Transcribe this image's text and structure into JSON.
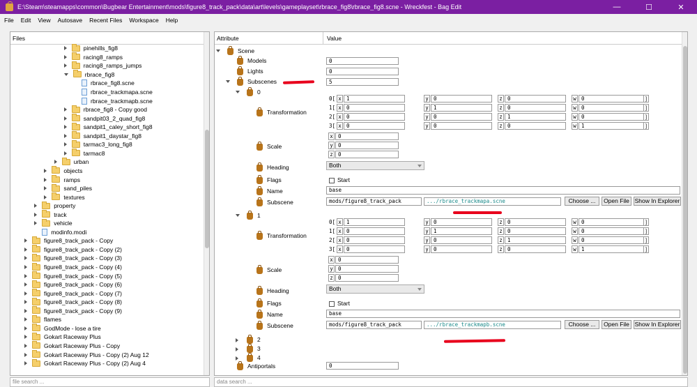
{
  "window": {
    "title": "E:\\Steam\\steamapps\\common\\Bugbear Entertainment\\mods\\figure8_track_pack\\data\\art\\levels\\gameplayset\\rbrace_fig8\\rbrace_fig8.scne - Wreckfest - Bag Edit",
    "min": "—",
    "max": "☐",
    "close": "✕"
  },
  "menu": [
    "File",
    "Edit",
    "View",
    "Autosave",
    "Recent Files",
    "Workspace",
    "Help"
  ],
  "files_panel": {
    "header": "Files",
    "search_placeholder": "file search ...",
    "items": [
      {
        "label": "pinehills_fig8",
        "depth": 4,
        "type": "folder",
        "arrow": "right"
      },
      {
        "label": "racing8_ramps",
        "depth": 4,
        "type": "folder",
        "arrow": "right"
      },
      {
        "label": "racing8_ramps_jumps",
        "depth": 4,
        "type": "folder",
        "arrow": "right"
      },
      {
        "label": "rbrace_fig8",
        "depth": 4,
        "type": "folder",
        "arrow": "down"
      },
      {
        "label": "rbrace_fig8.scne",
        "depth": 5,
        "type": "file",
        "arrow": "none"
      },
      {
        "label": "rbrace_trackmapa.scne",
        "depth": 5,
        "type": "file",
        "arrow": "none"
      },
      {
        "label": "rbrace_trackmapb.scne",
        "depth": 5,
        "type": "file",
        "arrow": "none"
      },
      {
        "label": "rbrace_fig8 - Copy good",
        "depth": 4,
        "type": "folder",
        "arrow": "right"
      },
      {
        "label": "sandpit03_2_quad_fig8",
        "depth": 4,
        "type": "folder",
        "arrow": "right"
      },
      {
        "label": "sandpit1_caley_short_fig8",
        "depth": 4,
        "type": "folder",
        "arrow": "right"
      },
      {
        "label": "sandpit1_daystar_fig8",
        "depth": 4,
        "type": "folder",
        "arrow": "right"
      },
      {
        "label": "tarmac3_long_fig8",
        "depth": 4,
        "type": "folder",
        "arrow": "right"
      },
      {
        "label": "tarmac8",
        "depth": 4,
        "type": "folder",
        "arrow": "right"
      },
      {
        "label": "urban",
        "depth": 3,
        "type": "folder",
        "arrow": "right"
      },
      {
        "label": "objects",
        "depth": 2,
        "type": "folder",
        "arrow": "right"
      },
      {
        "label": "ramps",
        "depth": 2,
        "type": "folder",
        "arrow": "right"
      },
      {
        "label": "sand_piles",
        "depth": 2,
        "type": "folder",
        "arrow": "right"
      },
      {
        "label": "textures",
        "depth": 2,
        "type": "folder",
        "arrow": "right"
      },
      {
        "label": "property",
        "depth": 1,
        "type": "folder",
        "arrow": "right"
      },
      {
        "label": "track",
        "depth": 1,
        "type": "folder",
        "arrow": "right"
      },
      {
        "label": "vehicle",
        "depth": 1,
        "type": "folder",
        "arrow": "right"
      },
      {
        "label": "modinfo.modi",
        "depth": 1,
        "type": "file",
        "arrow": "none"
      },
      {
        "label": "figure8_track_pack - Copy",
        "depth": 0,
        "type": "folder",
        "arrow": "right"
      },
      {
        "label": "figure8_track_pack - Copy (2)",
        "depth": 0,
        "type": "folder",
        "arrow": "right"
      },
      {
        "label": "figure8_track_pack - Copy (3)",
        "depth": 0,
        "type": "folder",
        "arrow": "right"
      },
      {
        "label": "figure8_track_pack - Copy (4)",
        "depth": 0,
        "type": "folder",
        "arrow": "right"
      },
      {
        "label": "figure8_track_pack - Copy (5)",
        "depth": 0,
        "type": "folder",
        "arrow": "right"
      },
      {
        "label": "figure8_track_pack - Copy (6)",
        "depth": 0,
        "type": "folder",
        "arrow": "right"
      },
      {
        "label": "figure8_track_pack - Copy (7)",
        "depth": 0,
        "type": "folder",
        "arrow": "right"
      },
      {
        "label": "figure8_track_pack - Copy (8)",
        "depth": 0,
        "type": "folder",
        "arrow": "right"
      },
      {
        "label": "figure8_track_pack - Copy (9)",
        "depth": 0,
        "type": "folder",
        "arrow": "right"
      },
      {
        "label": "flames",
        "depth": 0,
        "type": "folder",
        "arrow": "right"
      },
      {
        "label": "GodMode - lose a tire",
        "depth": 0,
        "type": "folder",
        "arrow": "right"
      },
      {
        "label": "Gokart Raceway Plus",
        "depth": 0,
        "type": "folder",
        "arrow": "right"
      },
      {
        "label": "Gokart Raceway Plus - Copy",
        "depth": 0,
        "type": "folder",
        "arrow": "right"
      },
      {
        "label": "Gokart Raceway Plus - Copy (2) Aug 12",
        "depth": 0,
        "type": "folder",
        "arrow": "right"
      },
      {
        "label": "Gokart Raceway Plus - Copy (2) Aug 4",
        "depth": 0,
        "type": "folder",
        "arrow": "right"
      }
    ]
  },
  "attr_panel": {
    "col_attribute": "Attribute",
    "col_value": "Value",
    "search_placeholder": "data search ...",
    "scene_label": "Scene",
    "models_label": "Models",
    "models_value": "0",
    "lights_label": "Lights",
    "lights_value": "0",
    "subscenes_label": "Subscenes",
    "subscenes_value": "5",
    "antiportals_label": "Antiportals",
    "antiportals_value": "0",
    "collapsed_subscenes": [
      "2",
      "3",
      "4"
    ],
    "row_prefixes": [
      "0[",
      "1[",
      "2[",
      "3["
    ],
    "axis": [
      "x",
      "y",
      "z",
      "w"
    ],
    "closing": "]",
    "subscenes": [
      {
        "index": "0",
        "transform_label": "Transformation",
        "matrix": [
          [
            "1",
            "0",
            "0",
            "0"
          ],
          [
            "0",
            "1",
            "0",
            "0"
          ],
          [
            "0",
            "0",
            "1",
            "0"
          ],
          [
            "0",
            "0",
            "0",
            "1"
          ]
        ],
        "scale_label": "Scale",
        "scale": [
          "0",
          "0",
          "0"
        ],
        "heading_label": "Heading",
        "heading_value": "Both",
        "flags_label": "Flags",
        "flag_start": "Start",
        "name_label": "Name",
        "name_value": "base",
        "subscene_label": "Subscene",
        "subscene_dir": "mods/figure8_track_pack",
        "subscene_file": ".../rbrace_trackmapa.scne"
      },
      {
        "index": "1",
        "transform_label": "Transformation",
        "matrix": [
          [
            "1",
            "0",
            "0",
            "0"
          ],
          [
            "0",
            "1",
            "0",
            "0"
          ],
          [
            "0",
            "0",
            "1",
            "0"
          ],
          [
            "0",
            "0",
            "0",
            "1"
          ]
        ],
        "scale_label": "Scale",
        "scale": [
          "0",
          "0",
          "0"
        ],
        "heading_label": "Heading",
        "heading_value": "Both",
        "flags_label": "Flags",
        "flag_start": "Start",
        "name_label": "Name",
        "name_value": "base",
        "subscene_label": "Subscene",
        "subscene_dir": "mods/figure8_track_pack",
        "subscene_file": ".../rbrace_trackmapb.scne"
      }
    ],
    "btn_choose": "Choose ...",
    "btn_open": "Open File",
    "btn_explorer": "Show In Explorer"
  },
  "colors": {
    "titlebar": "#7b1fa2",
    "annotation": "#e8001c",
    "link": "#1a8a8a"
  }
}
